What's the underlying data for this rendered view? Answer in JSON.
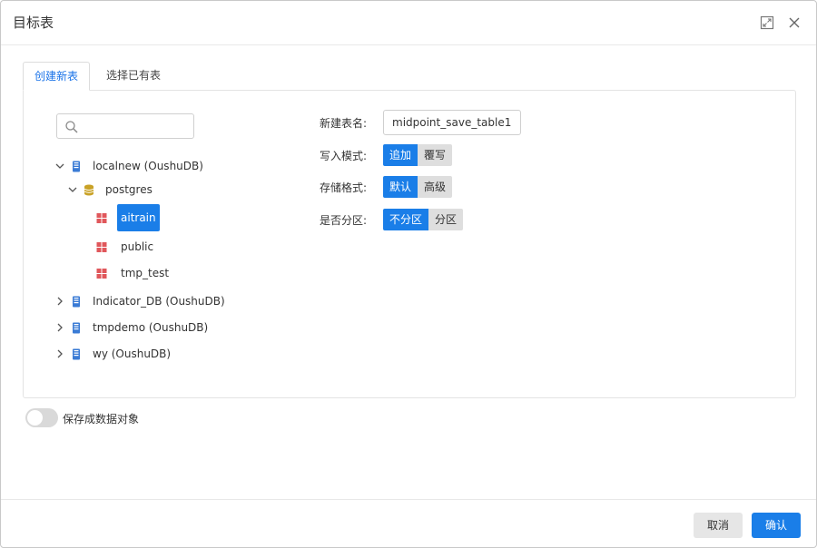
{
  "dialog": {
    "title": "目标表"
  },
  "tabs": [
    {
      "label": "创建新表",
      "active": true
    },
    {
      "label": "选择已有表",
      "active": false
    }
  ],
  "search": {
    "value": "",
    "placeholder": ""
  },
  "tree": {
    "localnew": {
      "label": "localnew (OushuDB)",
      "expanded": true
    },
    "postgres": {
      "label": "postgres",
      "expanded": true
    },
    "aitrain": {
      "label": "aitrain",
      "selected": true
    },
    "public": {
      "label": "public"
    },
    "tmp_test": {
      "label": "tmp_test"
    },
    "indicator_db": {
      "label": "Indicator_DB (OushuDB)",
      "expanded": false
    },
    "tmpdemo": {
      "label": "tmpdemo (OushuDB)",
      "expanded": false
    },
    "wy": {
      "label": "wy (OushuDB)",
      "expanded": false
    }
  },
  "form": {
    "table_name_label": "新建表名:",
    "table_name_value": "midpoint_save_table1",
    "write_mode_label": "写入模式:",
    "write_mode_options": [
      "追加",
      "覆写"
    ],
    "write_mode_selected": "追加",
    "storage_format_label": "存储格式:",
    "storage_format_options": [
      "默认",
      "高级"
    ],
    "storage_format_selected": "默认",
    "partition_label": "是否分区:",
    "partition_options": [
      "不分区",
      "分区"
    ],
    "partition_selected": "不分区"
  },
  "save_as_data_object": {
    "label": "保存成数据对象",
    "enabled": false
  },
  "footer": {
    "cancel_label": "取消",
    "ok_label": "确认"
  },
  "colors": {
    "accent": "#1a7ee8",
    "db_icon": "#3a7bd5",
    "schema_icon": "#c9a227",
    "table_icon": "#e0575b"
  },
  "icons": {
    "search": "search-icon",
    "maximize": "maximize-icon",
    "close": "close-icon",
    "database": "database-server-icon",
    "schema": "schema-cylinder-icon",
    "table": "table-grid-icon",
    "expanded": "chevron-down-icon",
    "collapsed": "chevron-right-icon"
  }
}
